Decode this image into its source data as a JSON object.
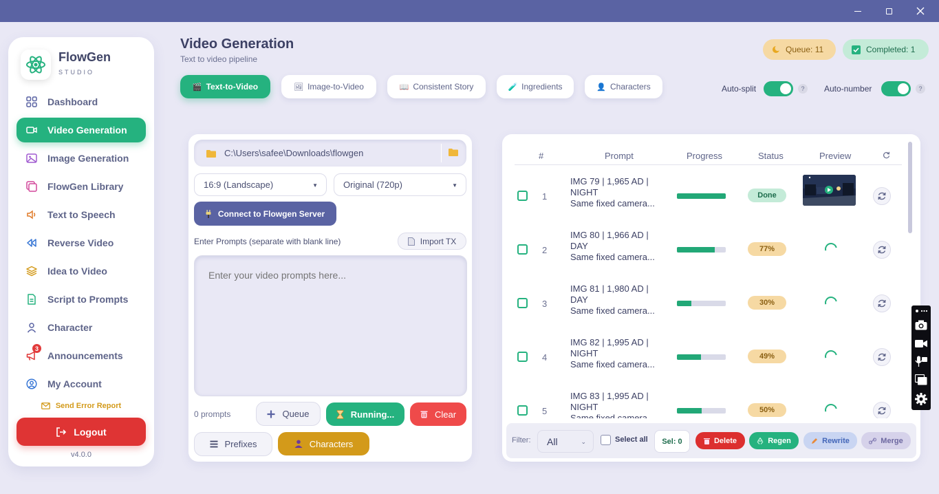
{
  "sidebar": {
    "brand": "FlowGen",
    "brand_sub": "STUDIO",
    "items": [
      {
        "label": "Dashboard",
        "icon": "grid-icon"
      },
      {
        "label": "Video Generation",
        "icon": "video-icon"
      },
      {
        "label": "Image Generation",
        "icon": "image-icon"
      },
      {
        "label": "FlowGen Library",
        "icon": "library-icon"
      },
      {
        "label": "Text to Speech",
        "icon": "speaker-icon"
      },
      {
        "label": "Reverse Video",
        "icon": "rewind-icon"
      },
      {
        "label": "Idea to Video",
        "icon": "layers-icon"
      },
      {
        "label": "Script to Prompts",
        "icon": "document-icon"
      },
      {
        "label": "Character",
        "icon": "user-icon"
      },
      {
        "label": "Announcements",
        "icon": "megaphone-icon",
        "badge": "3"
      },
      {
        "label": "My Account",
        "icon": "account-icon"
      }
    ],
    "error_report": "Send Error Report",
    "logout": "Logout",
    "version": "v4.0.0"
  },
  "header": {
    "title": "Video Generation",
    "subtitle": "Text to video pipeline",
    "queue": "Queue: 11",
    "completed": "Completed: 1"
  },
  "tabs": [
    {
      "label": "Text-to-Video",
      "icon": "🎬"
    },
    {
      "label": "Image-to-Video",
      "icon": "🖼"
    },
    {
      "label": "Consistent Story",
      "icon": "📖"
    },
    {
      "label": "Ingredients",
      "icon": "🧪"
    },
    {
      "label": "Characters",
      "icon": "👤"
    }
  ],
  "toggles": {
    "auto_split": "Auto-split",
    "auto_number": "Auto-number",
    "help": "?"
  },
  "left": {
    "path": "C:\\Users\\safee\\Downloads\\flowgen",
    "aspect": "16:9 (Landscape)",
    "quality": "Original (720p)",
    "connect": "Connect to Flowgen Server",
    "prompts_label": "Enter Prompts (separate with blank line)",
    "import": "Import TX",
    "placeholder": "Enter your video prompts here...",
    "count": "0 prompts",
    "queue_btn": "Queue",
    "running_btn": "Running...",
    "clear_btn": "Clear",
    "prefixes_btn": "Prefixes",
    "characters_btn": "Characters"
  },
  "table": {
    "headers": {
      "num": "#",
      "prompt": "Prompt",
      "progress": "Progress",
      "status": "Status",
      "preview": "Preview"
    },
    "rows": [
      {
        "num": "1",
        "l1": "IMG 79 | 1,965 AD |",
        "l2": "NIGHT",
        "l3": "Same fixed camera...",
        "progress": 1.0,
        "status": "Done",
        "preview": "thumbnail"
      },
      {
        "num": "2",
        "l1": "IMG 80 | 1,966 AD |",
        "l2": "DAY",
        "l3": "Same fixed camera...",
        "progress": 0.77,
        "status": "77%",
        "preview": "spinner"
      },
      {
        "num": "3",
        "l1": "IMG 81 | 1,980 AD |",
        "l2": "DAY",
        "l3": "Same fixed camera...",
        "progress": 0.3,
        "status": "30%",
        "preview": "spinner"
      },
      {
        "num": "4",
        "l1": "IMG 82 | 1,995 AD |",
        "l2": "NIGHT",
        "l3": "Same fixed camera...",
        "progress": 0.49,
        "status": "49%",
        "preview": "spinner"
      },
      {
        "num": "5",
        "l1": "IMG 83 | 1,995 AD |",
        "l2": "NIGHT",
        "l3": "Same fixed camera...",
        "progress": 0.5,
        "status": "50%",
        "preview": "spinner"
      }
    ]
  },
  "footer": {
    "filter_label": "Filter:",
    "filter_value": "All",
    "select_all": "Select all",
    "sel_count": "Sel: 0",
    "delete": "Delete",
    "regen": "Regen",
    "rewrite": "Rewrite",
    "merge": "Merge"
  },
  "colors": {
    "accent": "#25b27f",
    "primary": "#5a63a3",
    "danger": "#df3434",
    "warning": "#d39a1a"
  }
}
